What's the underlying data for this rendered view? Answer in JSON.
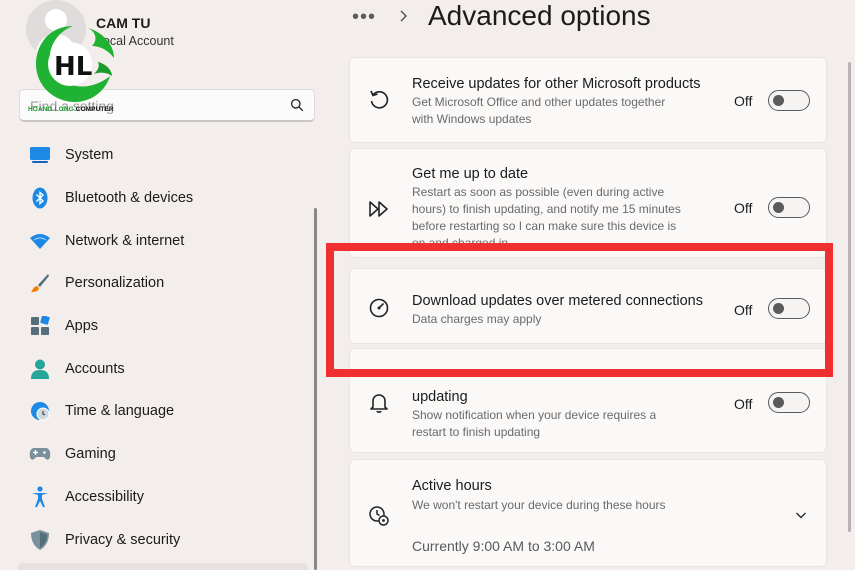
{
  "user": {
    "name": "CAM TU",
    "account_type": "Local Account"
  },
  "watermark": {
    "brand_part1": "HOANG LONG",
    "brand_part2": "COMPUTER",
    "mark": "HL"
  },
  "search": {
    "placeholder": "Find a setting"
  },
  "nav": {
    "items": [
      {
        "label": "System"
      },
      {
        "label": "Bluetooth & devices"
      },
      {
        "label": "Network & internet"
      },
      {
        "label": "Personalization"
      },
      {
        "label": "Apps"
      },
      {
        "label": "Accounts"
      },
      {
        "label": "Time & language"
      },
      {
        "label": "Gaming"
      },
      {
        "label": "Accessibility"
      },
      {
        "label": "Privacy & security"
      }
    ]
  },
  "header": {
    "more": "•••",
    "title": "Advanced options"
  },
  "cards": {
    "receive_updates": {
      "title": "Receive updates for other Microsoft products",
      "desc_line1": "Get Microsoft Office and other updates together",
      "desc_line2": "with Windows updates",
      "state": "Off"
    },
    "up_to_date": {
      "title": "Get me up to date",
      "desc_line1": "Restart as soon as possible (even during active",
      "desc_line2": "hours) to finish updating, and notify me 15 minutes",
      "desc_line3": "before restarting so I can make sure this device is",
      "desc_line4": "on and charged in",
      "state": "Off"
    },
    "metered": {
      "title": "Download updates over metered connections",
      "desc": "Data charges may apply",
      "state": "Off"
    },
    "notify": {
      "title": "updating",
      "desc_line1": "Show notification when your device requires a",
      "desc_line2": "restart to finish updating",
      "state": "Off"
    },
    "active_hours": {
      "title": "Active hours",
      "desc": "We won't restart your device during these hours",
      "current": "Currently 9:00 AM to 3:00 AM"
    }
  },
  "colors": {
    "highlight": "#f03030",
    "accent_green": "#1a9c2b"
  }
}
